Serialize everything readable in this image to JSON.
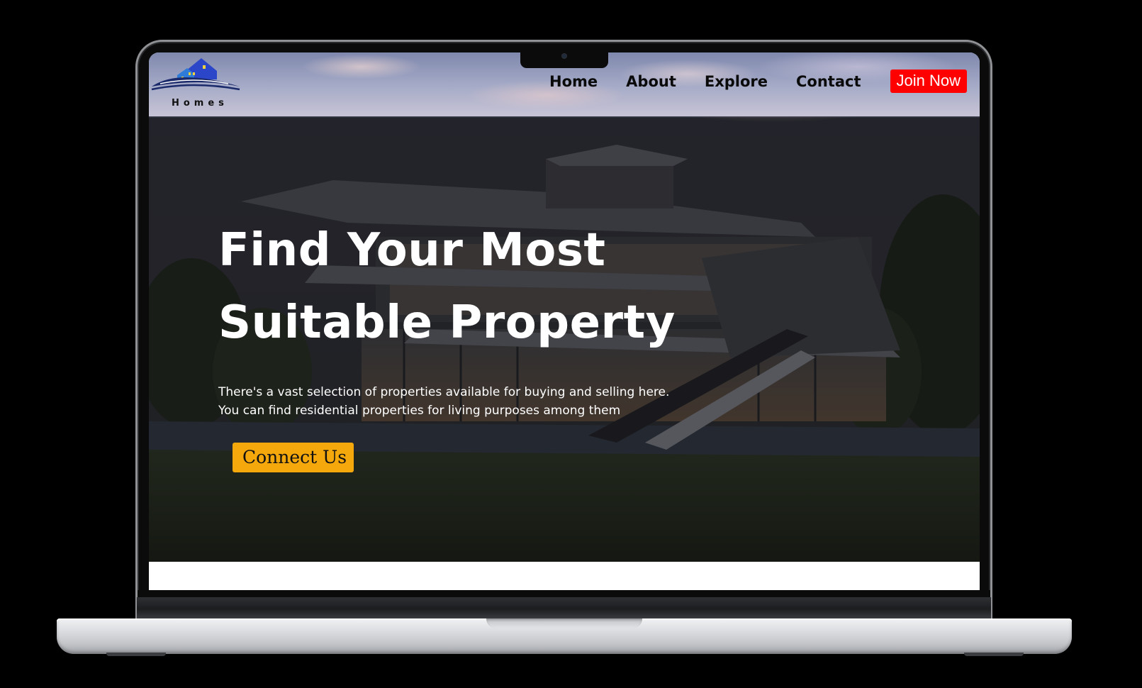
{
  "brand": {
    "name": "Homes",
    "logo_colors": {
      "roof": "#2b46c8",
      "wave": "#1b2a6b",
      "window": "#f0d23c"
    }
  },
  "nav": {
    "links": [
      {
        "label": "Home"
      },
      {
        "label": "About"
      },
      {
        "label": "Explore"
      },
      {
        "label": "Contact"
      }
    ],
    "join_label": "Join Now",
    "join_color": "#ff0000"
  },
  "hero": {
    "title_line1": "Find Your Most",
    "title_line2": "Suitable Property",
    "subtitle_line1": "There's a vast selection of properties available for buying and selling here.",
    "subtitle_line2": "You can find residential properties for living purposes among them",
    "cta_label": "Connect Us",
    "cta_color": "#f5a80b"
  }
}
